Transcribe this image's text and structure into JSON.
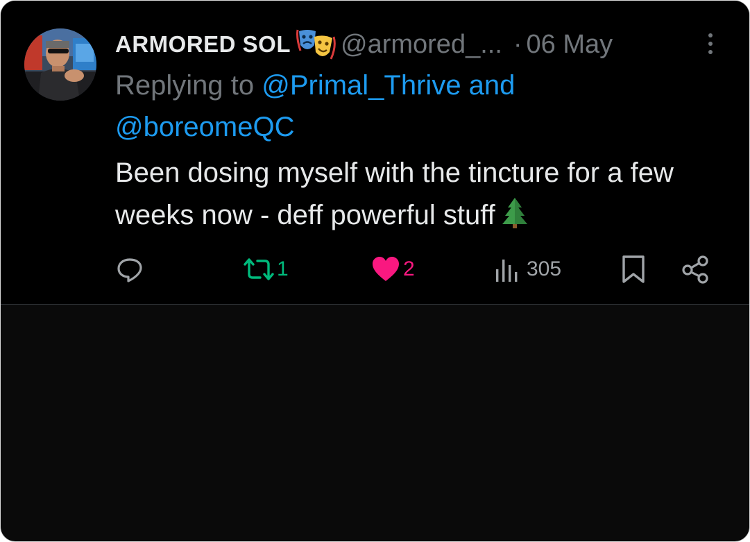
{
  "tweet": {
    "display_name": "ARMORED SOL",
    "handle": "@armored_...",
    "separator": "·",
    "date": "06 May",
    "replying_prefix": "Replying to ",
    "mention_1": "@Primal_Thrive",
    "mention_joiner": " and ",
    "mention_2": "@boreomeQC",
    "text": "Been dosing myself with the tincture for a few weeks now - deff powerful stuff",
    "emoji_name": "performing-arts-icon",
    "text_emoji": "evergreen-tree-icon"
  },
  "actions": {
    "reply": {
      "icon": "reply-icon"
    },
    "retweet": {
      "icon": "retweet-icon",
      "count": "1"
    },
    "like": {
      "icon": "heart-icon",
      "count": "2"
    },
    "views": {
      "icon": "views-icon",
      "count": "305"
    },
    "bookmark": {
      "icon": "bookmark-icon"
    },
    "share": {
      "icon": "share-icon"
    }
  },
  "colors": {
    "background": "#000000",
    "text": "#e7e9ea",
    "secondary": "#71767b",
    "mention": "#1d9bf0",
    "retweet": "#00ba7c",
    "like": "#f91880"
  }
}
